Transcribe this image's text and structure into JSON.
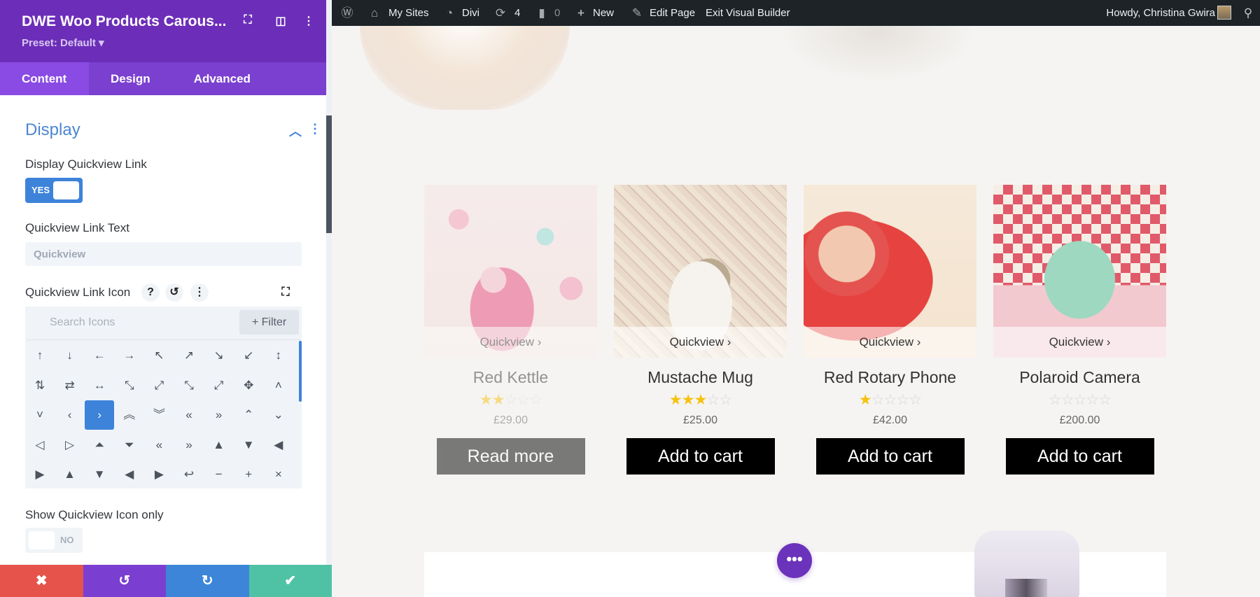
{
  "sidebar": {
    "title": "DWE Woo Products Carous...",
    "preset": "Preset: Default ▾",
    "tabs": [
      "Content",
      "Design",
      "Advanced"
    ],
    "section_title": "Display",
    "display_quickview_label": "Display Quickview Link",
    "display_quickview_toggle": "YES",
    "link_text_label": "Quickview Link Text",
    "link_text_placeholder": "Quickview",
    "link_icon_label": "Quickview Link Icon",
    "icon_search_placeholder": "Search Icons",
    "filter_label": "+ Filter",
    "icons": [
      "↑",
      "↓",
      "←",
      "→",
      "↖",
      "↗",
      "↘",
      "↙",
      "↕",
      "⇅",
      "⇄",
      "↔",
      "⤡",
      "⤢",
      "⤡",
      "⤢",
      "✥",
      "˄",
      "˅",
      "‹",
      "›",
      "︽",
      "︾",
      "«",
      "»",
      "⌃",
      "⌄",
      "◁",
      "▷",
      "⏶",
      "⏷",
      "«",
      "»",
      "▲",
      "▼",
      "◀",
      "▶",
      "▲",
      "▼",
      "◀",
      "▶",
      "↩",
      "−",
      "+",
      "×"
    ],
    "selected_icon_index": 20,
    "icon_only_label": "Show Quickview Icon only",
    "icon_only_toggle": "NO",
    "footer": {
      "discard": "✖",
      "undo": "↺",
      "redo": "↻",
      "save": "✔"
    },
    "colors": {
      "header": "#6c2eb9",
      "accent": "#3d83da",
      "discard": "#e5534b",
      "undo": "#7a3fd1",
      "redo": "#3c85d9",
      "save": "#4fc2a6"
    }
  },
  "adminbar": {
    "my_sites": "My Sites",
    "divi": "Divi",
    "updates": "4",
    "comments": "0",
    "new": "New",
    "edit_page": "Edit Page",
    "exit_builder": "Exit Visual Builder",
    "howdy": "Howdy, Christina Gwira"
  },
  "products": [
    {
      "name": "Red Kettle",
      "rating": 2,
      "price": "£29.00",
      "button": "Read more",
      "quickview": "Quickview ›",
      "faded": true
    },
    {
      "name": "Mustache Mug",
      "rating": 3,
      "price": "£25.00",
      "button": "Add to cart",
      "quickview": "Quickview ›",
      "faded": false
    },
    {
      "name": "Red Rotary Phone",
      "rating": 1,
      "price": "£42.00",
      "button": "Add to cart",
      "quickview": "Quickview ›",
      "faded": false
    },
    {
      "name": "Polaroid Camera",
      "rating": 0,
      "price": "£200.00",
      "button": "Add to cart",
      "quickview": "Quickview ›",
      "faded": false
    }
  ],
  "fab_label": "•••"
}
